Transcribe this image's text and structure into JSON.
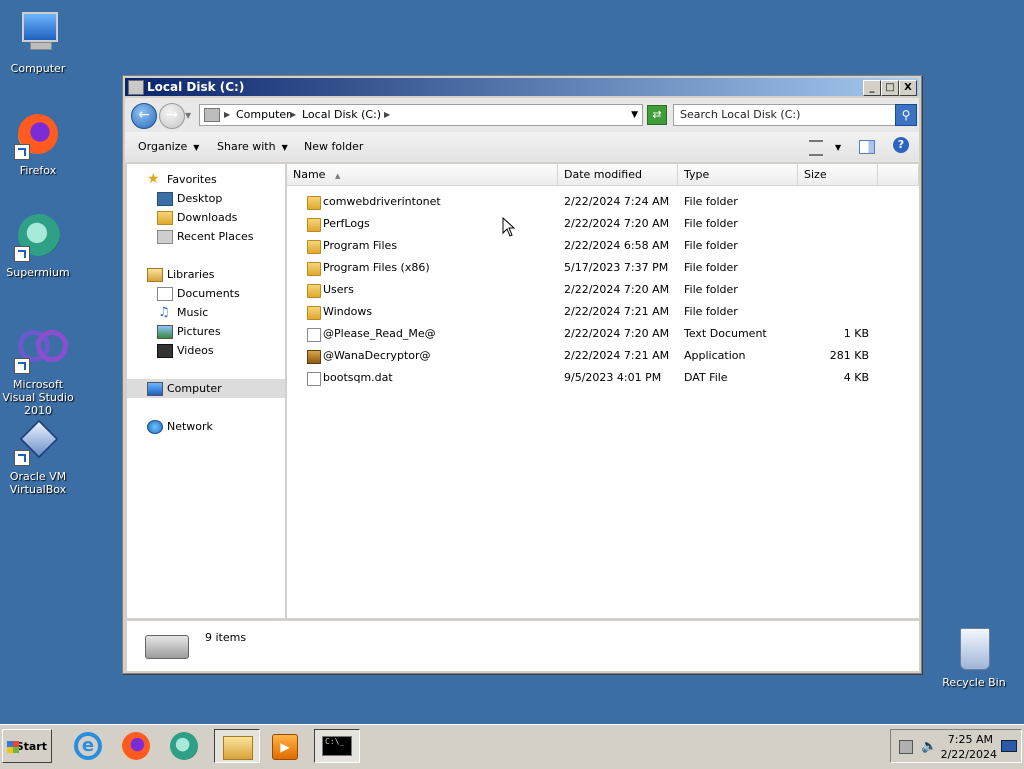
{
  "desktop": {
    "icons": [
      {
        "label": "Computer"
      },
      {
        "label": "Firefox"
      },
      {
        "label": "Supermium"
      },
      {
        "label": "Microsoft Visual Studio 2010"
      },
      {
        "label": "Oracle VM VirtualBox"
      },
      {
        "label": "Recycle Bin"
      }
    ]
  },
  "window": {
    "title": "Local Disk (C:)",
    "buttons": {
      "minimize": "_",
      "maximize": "□",
      "close": "X"
    },
    "address": {
      "segments": [
        "Computer",
        "Local Disk (C:)"
      ]
    },
    "search_placeholder": "Search Local Disk (C:)",
    "toolbar": {
      "organize": "Organize",
      "share_with": "Share with",
      "new_folder": "New folder",
      "help": "?"
    },
    "nav": {
      "favorites": "Favorites",
      "desktop": "Desktop",
      "downloads": "Downloads",
      "recent_places": "Recent Places",
      "libraries": "Libraries",
      "documents": "Documents",
      "music": "Music",
      "pictures": "Pictures",
      "videos": "Videos",
      "computer": "Computer",
      "network": "Network"
    },
    "columns": {
      "name": "Name",
      "date_modified": "Date modified",
      "type": "Type",
      "size": "Size"
    },
    "files": [
      {
        "name": "comwebdriverintonet",
        "date": "2/22/2024 7:24 AM",
        "type": "File folder",
        "size": "",
        "icon": "folder"
      },
      {
        "name": "PerfLogs",
        "date": "2/22/2024 7:20 AM",
        "type": "File folder",
        "size": "",
        "icon": "folder"
      },
      {
        "name": "Program Files",
        "date": "2/22/2024 6:58 AM",
        "type": "File folder",
        "size": "",
        "icon": "folder"
      },
      {
        "name": "Program Files (x86)",
        "date": "5/17/2023 7:37 PM",
        "type": "File folder",
        "size": "",
        "icon": "folder"
      },
      {
        "name": "Users",
        "date": "2/22/2024 7:20 AM",
        "type": "File folder",
        "size": "",
        "icon": "folder"
      },
      {
        "name": "Windows",
        "date": "2/22/2024 7:21 AM",
        "type": "File folder",
        "size": "",
        "icon": "folder"
      },
      {
        "name": "@Please_Read_Me@",
        "date": "2/22/2024 7:20 AM",
        "type": "Text Document",
        "size": "1 KB",
        "icon": "doc"
      },
      {
        "name": "@WanaDecryptor@",
        "date": "2/22/2024 7:21 AM",
        "type": "Application",
        "size": "281 KB",
        "icon": "app"
      },
      {
        "name": "bootsqm.dat",
        "date": "9/5/2023 4:01 PM",
        "type": "DAT File",
        "size": "4 KB",
        "icon": "doc"
      }
    ],
    "details": {
      "count": "9 items"
    }
  },
  "taskbar": {
    "start": "Start",
    "clock": {
      "time": "7:25 AM",
      "date": "2/22/2024"
    },
    "cmd_label": "C:\\_"
  }
}
